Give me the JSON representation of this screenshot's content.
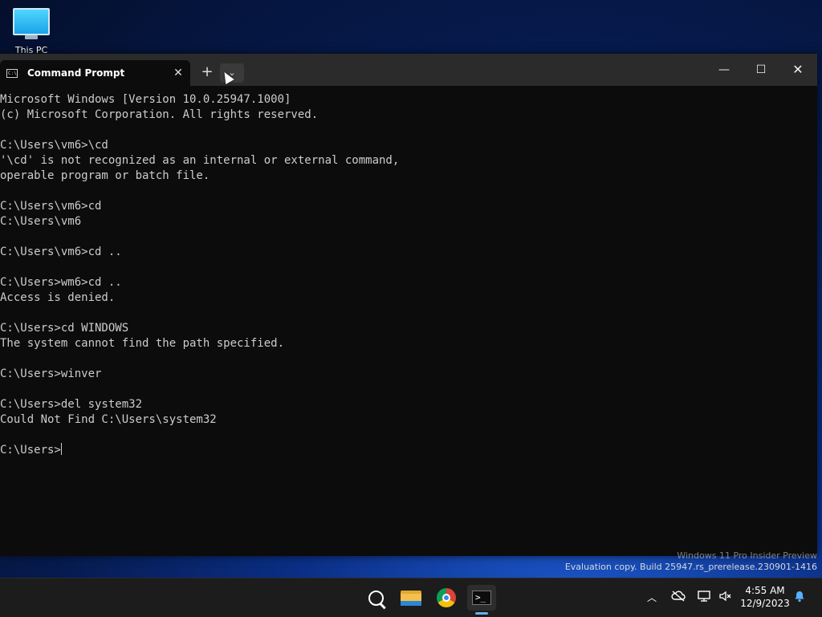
{
  "desktop": {
    "icon_label": "This PC"
  },
  "window": {
    "tab_icon_text": "C:\\",
    "tab_title": "Command Prompt",
    "tab_close": "✕",
    "new_tab": "+",
    "dropdown": "⌄",
    "minimize": "—",
    "maximize": "☐",
    "close": "✕"
  },
  "terminal": {
    "lines": [
      "Microsoft Windows [Version 10.0.25947.1000]",
      "(c) Microsoft Corporation. All rights reserved.",
      "",
      "C:\\Users\\vm6>\\cd",
      "'\\cd' is not recognized as an internal or external command,",
      "operable program or batch file.",
      "",
      "C:\\Users\\vm6>cd",
      "C:\\Users\\vm6",
      "",
      "C:\\Users\\vm6>cd ..",
      "",
      "C:\\Users>wm6>cd ..",
      "Access is denied.",
      "",
      "C:\\Users>cd WINDOWS",
      "The system cannot find the path specified.",
      "",
      "C:\\Users>winver",
      "",
      "C:\\Users>del system32",
      "Could Not Find C:\\Users\\system32",
      ""
    ],
    "prompt": "C:\\Users>"
  },
  "watermark": {
    "edition": "Windows 11 Pro Insider Preview",
    "build": "Evaluation copy. Build 25947.rs_prerelease.230901-1416"
  },
  "taskbar": {
    "tray_chevron": "︿",
    "time": "4:55 AM",
    "date": "12/9/2023",
    "icons": [
      "windows-start-icon",
      "search-icon",
      "file-explorer-icon",
      "chrome-icon",
      "terminal-icon",
      "cloud-offline-icon",
      "network-icon",
      "volume-muted-icon",
      "notification-bell-icon"
    ],
    "accent_color": "#5fb2f0"
  }
}
